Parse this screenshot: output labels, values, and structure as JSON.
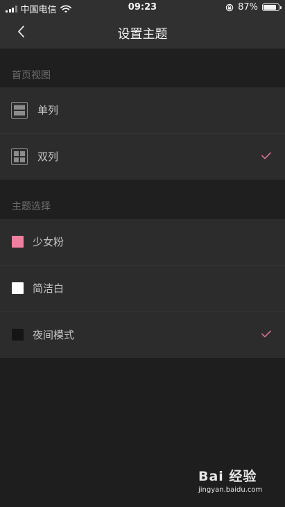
{
  "status_bar": {
    "carrier": "中国电信",
    "time": "09:23",
    "battery": "87%",
    "battery_level": 0.87
  },
  "nav": {
    "title": "设置主题"
  },
  "home_view": {
    "header": "首页视图",
    "options": [
      {
        "label": "单列",
        "icon": "single-column-icon",
        "selected": false
      },
      {
        "label": "双列",
        "icon": "double-column-icon",
        "selected": true
      }
    ]
  },
  "theme": {
    "header": "主题选择",
    "options": [
      {
        "label": "少女粉",
        "color": "#ee7f9f",
        "selected": false
      },
      {
        "label": "简洁白",
        "color": "#ffffff",
        "selected": false
      },
      {
        "label": "夜间模式",
        "color": "#151515",
        "selected": true
      }
    ]
  },
  "colors": {
    "check": "#d3718d",
    "background": "#1e1e1f",
    "card": "#2c2c2d"
  },
  "watermark": {
    "brand": "Bai 经验",
    "url": "jingyan.baidu.com"
  }
}
